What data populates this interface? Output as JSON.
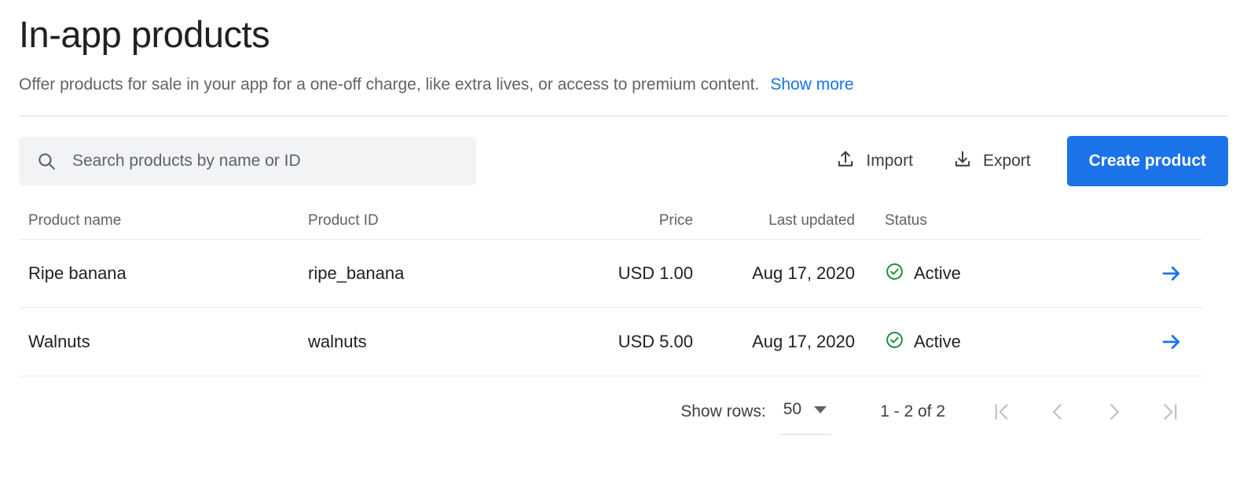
{
  "header": {
    "title": "In-app products",
    "subtitle": "Offer products for sale in your app for a one-off charge, like extra lives, or access to premium content.",
    "show_more_label": "Show more"
  },
  "toolbar": {
    "search_placeholder": "Search products by name or ID",
    "search_value": "",
    "import_label": "Import",
    "export_label": "Export",
    "create_label": "Create product"
  },
  "table": {
    "columns": [
      "Product name",
      "Product ID",
      "Price",
      "Last updated",
      "Status"
    ],
    "rows": [
      {
        "name": "Ripe banana",
        "id": "ripe_banana",
        "price": "USD 1.00",
        "last_updated": "Aug 17, 2020",
        "status": "Active"
      },
      {
        "name": "Walnuts",
        "id": "walnuts",
        "price": "USD 5.00",
        "last_updated": "Aug 17, 2020",
        "status": "Active"
      }
    ]
  },
  "footer": {
    "show_rows_label": "Show rows:",
    "rows_per_page": "50",
    "range_label": "1 - 2 of 2"
  },
  "colors": {
    "accent_blue": "#1a73e8",
    "status_green": "#1e8e3e",
    "text_primary": "#202124",
    "text_secondary": "#5f6368",
    "divider": "#e8eaed",
    "search_background": "#f1f3f4",
    "pager_disabled": "#bdc1c6"
  },
  "icons": {
    "search": "search-icon",
    "import": "upload-icon",
    "export": "download-icon",
    "status": "check-circle-icon",
    "row_action": "arrow-right-icon",
    "rows_caret": "chevron-down-icon",
    "first_page": "first-page-icon",
    "previous_page": "previous-page-icon",
    "next_page": "next-page-icon",
    "last_page": "last-page-icon"
  }
}
